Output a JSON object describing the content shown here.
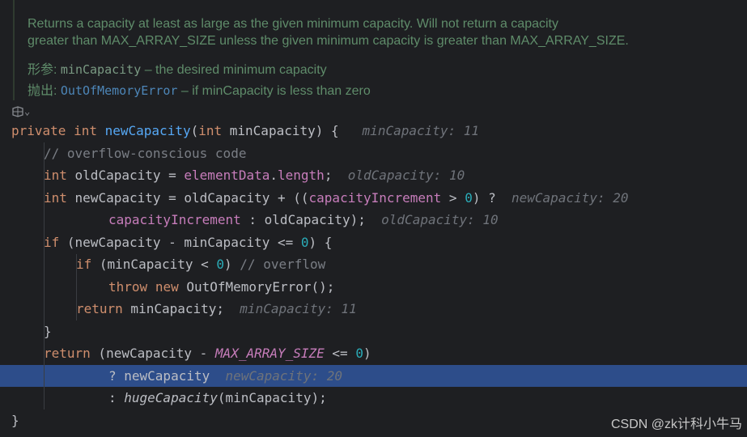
{
  "doc": {
    "line1": "Returns a capacity at least as large as the given minimum capacity. Will not return a capacity",
    "line2": "greater than MAX_ARRAY_SIZE unless the given minimum capacity is greater than MAX_ARRAY_SIZE.",
    "param_label": "形参:",
    "param_name": "minCapacity",
    "param_desc": " – the desired minimum capacity",
    "throws_label": "抛出:",
    "throws_name": "OutOfMemoryError",
    "throws_desc": " – if minCapacity is less than zero"
  },
  "reader_mode": {
    "icon": "reader-mode-icon",
    "chevron": "⌄"
  },
  "code": {
    "l1": {
      "kw1": "private",
      "kw2": "int",
      "fn": "newCapacity",
      "p1": "(",
      "kw3": "int",
      "rest": " minCapacity) {",
      "hint": "minCapacity: 11"
    },
    "l2": {
      "comment": "// overflow-conscious code"
    },
    "l3": {
      "kw": "int",
      "a": " oldCapacity = ",
      "f1": "elementData",
      "b": ".",
      "f2": "length",
      "c": ";",
      "hint": "oldCapacity: 10"
    },
    "l4": {
      "kw": "int",
      "a": " newCapacity = oldCapacity + ((",
      "f": "capacityIncrement",
      "b": " > ",
      "n": "0",
      "c": ") ?",
      "hint": "newCapacity: 20"
    },
    "l5": {
      "f": "capacityIncrement",
      "a": " : oldCapacity);",
      "hint": "oldCapacity: 10"
    },
    "l6": {
      "kw": "if",
      "a": " (newCapacity - minCapacity <= ",
      "n": "0",
      "b": ") {"
    },
    "l7": {
      "kw": "if",
      "a": " (minCapacity < ",
      "n": "0",
      "b": ") ",
      "comment": "// overflow"
    },
    "l8": {
      "kw1": "throw",
      "kw2": "new",
      "a": " OutOfMemoryError();"
    },
    "l9": {
      "kw": "return",
      "a": " minCapacity;",
      "hint": "minCapacity: 11"
    },
    "l10": {
      "a": "}"
    },
    "l11": {
      "kw": "return",
      "a": " (newCapacity - ",
      "s": "MAX_ARRAY_SIZE",
      "b": " <= ",
      "n": "0",
      "c": ")"
    },
    "l12": {
      "a": "? newCapacity",
      "hint": "newCapacity: 20"
    },
    "l13": {
      "a": ": ",
      "call": "hugeCapacity",
      "b": "(minCapacity);"
    },
    "l14": {
      "a": "}"
    }
  },
  "watermark": "CSDN @zk计科小牛马",
  "colors": {
    "background": "#1e1f22",
    "keyword": "#cf8e6d",
    "function": "#56a8f5",
    "field": "#c77dbb",
    "number": "#2aacb8",
    "comment": "#7a7e85",
    "inlay_hint": "#6f737a",
    "selection": "#2d4d8a",
    "doc_text": "#5f8c6a"
  }
}
